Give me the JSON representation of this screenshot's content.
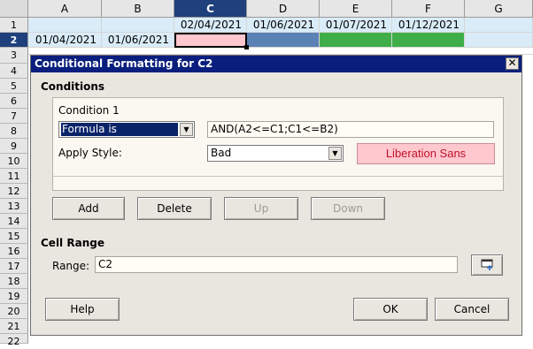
{
  "spreadsheet": {
    "columns": [
      "A",
      "B",
      "C",
      "D",
      "E",
      "F",
      "G"
    ],
    "selected_column": "C",
    "rows": [
      "1",
      "2",
      "3",
      "4",
      "5",
      "6",
      "7",
      "8",
      "9",
      "10",
      "11",
      "12",
      "13",
      "14",
      "15",
      "16",
      "17",
      "18",
      "19",
      "20",
      "21",
      "22"
    ],
    "selected_row": "2",
    "row1": {
      "C": "02/04/2021",
      "D": "01/06/2021",
      "E": "01/07/2021",
      "F": "01/12/2021"
    },
    "row2": {
      "A": "01/04/2021",
      "B": "01/06/2021"
    },
    "colors": {
      "C2": "#ffc7ce",
      "D2": "#5b82b5",
      "E2F2": "#3fae49",
      "row1_fill": "#d9ecf8",
      "header_selected": "#1f3f7d"
    }
  },
  "dialog": {
    "title": "Conditional Formatting for C2",
    "close_glyph": "✕",
    "conditions_heading": "Conditions",
    "condition_label": "Condition 1",
    "condition_type": "Formula is",
    "formula": "AND(A2<=C1;C1<=B2)",
    "apply_style_label": "Apply Style:",
    "apply_style_value": "Bad",
    "style_preview": "Liberation Sans",
    "buttons": {
      "add": "Add",
      "delete": "Delete",
      "up": "Up",
      "down": "Down"
    },
    "cell_range_heading": "Cell Range",
    "range_label": "Range:",
    "range_value": "C2",
    "range_button_icon": "shrink-icon",
    "help": "Help",
    "ok": "OK",
    "cancel": "Cancel"
  }
}
